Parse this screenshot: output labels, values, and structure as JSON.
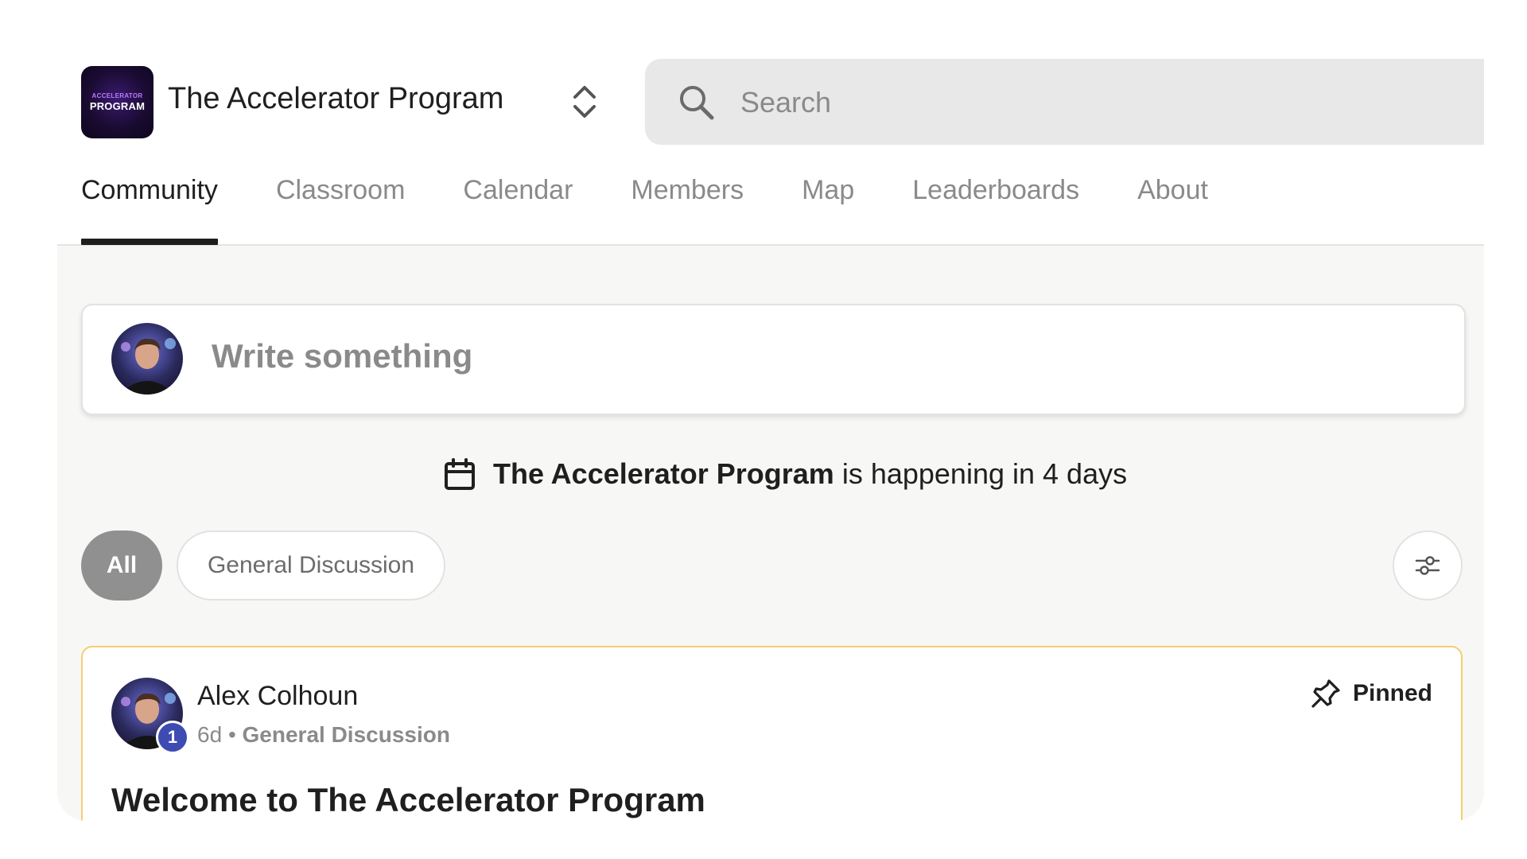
{
  "header": {
    "logo": {
      "line1": "ACCELERATOR",
      "line2": "PROGRAM"
    },
    "title": "The Accelerator Program",
    "switcher_icon": "chevron-up-down-icon",
    "search": {
      "placeholder": "Search",
      "value": "",
      "icon": "search-icon"
    }
  },
  "nav": {
    "tabs": [
      {
        "label": "Community",
        "active": true
      },
      {
        "label": "Classroom",
        "active": false
      },
      {
        "label": "Calendar",
        "active": false
      },
      {
        "label": "Members",
        "active": false
      },
      {
        "label": "Map",
        "active": false
      },
      {
        "label": "Leaderboards",
        "active": false
      },
      {
        "label": "About",
        "active": false
      }
    ]
  },
  "composer": {
    "placeholder": "Write something"
  },
  "event": {
    "icon": "calendar-icon",
    "name": "The Accelerator Program",
    "text": "is happening in 4 days"
  },
  "filters": {
    "chips": [
      {
        "label": "All",
        "selected": true
      },
      {
        "label": "General Discussion",
        "selected": false
      }
    ],
    "settings_icon": "sliders-icon"
  },
  "post": {
    "author": "Alex Colhoun",
    "level": "1",
    "age": "6d",
    "separator": "•",
    "category": "General Discussion",
    "pinned_label": "Pinned",
    "pin_icon": "pin-icon",
    "title": "Welcome to The Accelerator Program"
  },
  "colors": {
    "accent_dark": "#1f1f1f",
    "muted_text": "#8a8a8a",
    "chip_selected_bg": "#909090",
    "pinned_border": "#f3cf70",
    "level_badge": "#3d4bb3",
    "page_bg": "#f7f7f5"
  }
}
